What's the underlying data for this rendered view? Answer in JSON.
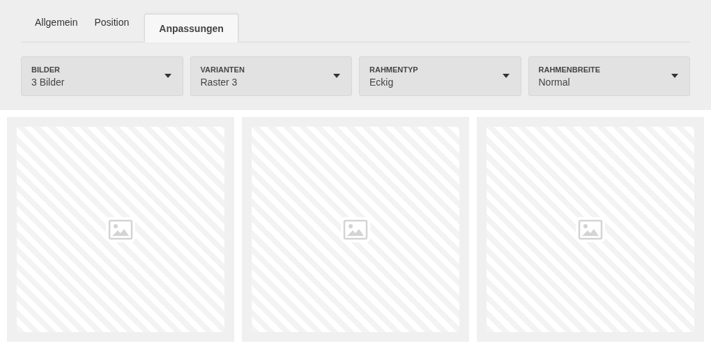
{
  "tabs": [
    {
      "label": "Allgemein",
      "selected": false
    },
    {
      "label": "Position",
      "selected": false
    },
    {
      "label": "Anpassungen",
      "selected": true
    }
  ],
  "dropdowns": [
    {
      "label": "BILDER",
      "value": "3 Bilder"
    },
    {
      "label": "VARIANTEN",
      "value": "Raster 3"
    },
    {
      "label": "RAHMENTYP",
      "value": "Eckig"
    },
    {
      "label": "RAHMENBREITE",
      "value": "Normal"
    }
  ],
  "images": [
    {
      "kind": "placeholder"
    },
    {
      "kind": "placeholder"
    },
    {
      "kind": "placeholder"
    }
  ]
}
